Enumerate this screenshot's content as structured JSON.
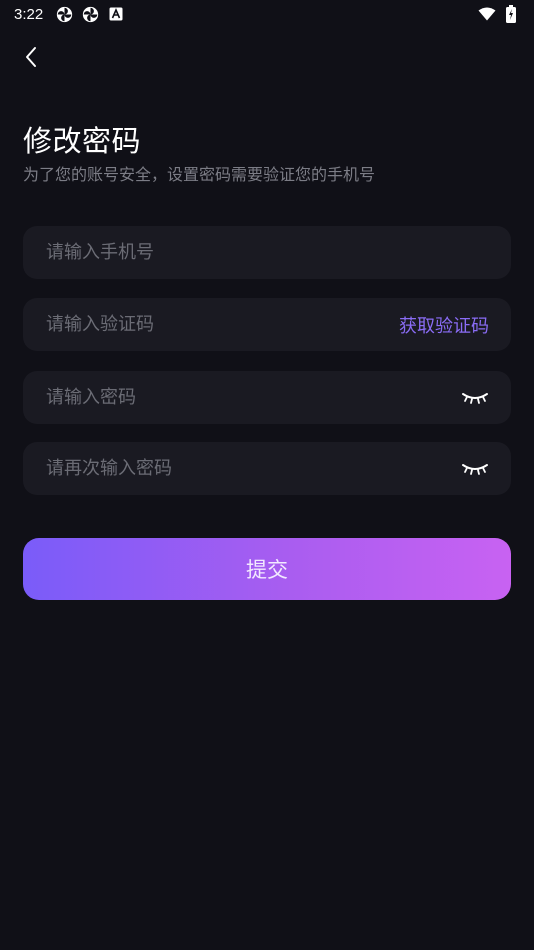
{
  "status_bar": {
    "time": "3:22",
    "notification_icons": [
      "pinwheel-icon",
      "pinwheel-icon",
      "a-box-icon"
    ],
    "right_icons": [
      "wifi-icon",
      "battery-charging-icon"
    ]
  },
  "header": {
    "back_icon": "chevron-left-icon",
    "title": "修改密码",
    "subtitle": "为了您的账号安全，设置密码需要验证您的手机号"
  },
  "form": {
    "phone": {
      "placeholder": "请输入手机号",
      "value": ""
    },
    "code": {
      "placeholder": "请输入验证码",
      "value": "",
      "get_code_label": "获取验证码"
    },
    "password": {
      "placeholder": "请输入密码",
      "value": "",
      "toggle_icon": "eye-closed-icon"
    },
    "confirm_password": {
      "placeholder": "请再次输入密码",
      "value": "",
      "toggle_icon": "eye-closed-icon"
    }
  },
  "submit_label": "提交",
  "colors": {
    "background": "#101017",
    "field_background": "#1a1a22",
    "accent": "#8a6cf5",
    "button_gradient_start": "#7a5cf9",
    "button_gradient_end": "#c862f2"
  }
}
